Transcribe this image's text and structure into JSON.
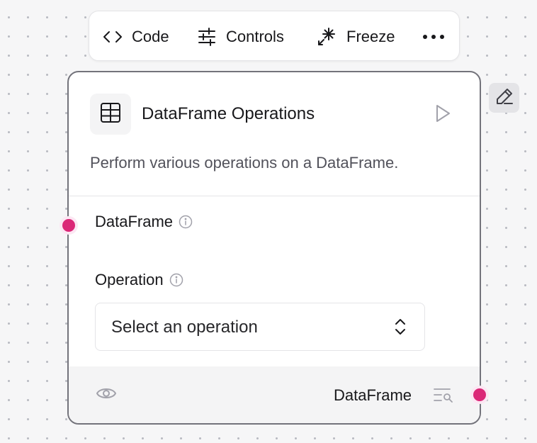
{
  "toolbar": {
    "code_label": "Code",
    "controls_label": "Controls",
    "freeze_label": "Freeze"
  },
  "node": {
    "title": "DataFrame Operations",
    "description": "Perform various operations on a DataFrame.",
    "icon": "table-icon",
    "inputs": {
      "dataframe_label": "DataFrame",
      "operation_label": "Operation",
      "operation_placeholder": "Select an operation"
    },
    "output": {
      "label": "DataFrame"
    }
  },
  "colors": {
    "handle": "#db2777",
    "card_border": "#73737b",
    "footer_bg": "#f4f4f5"
  }
}
